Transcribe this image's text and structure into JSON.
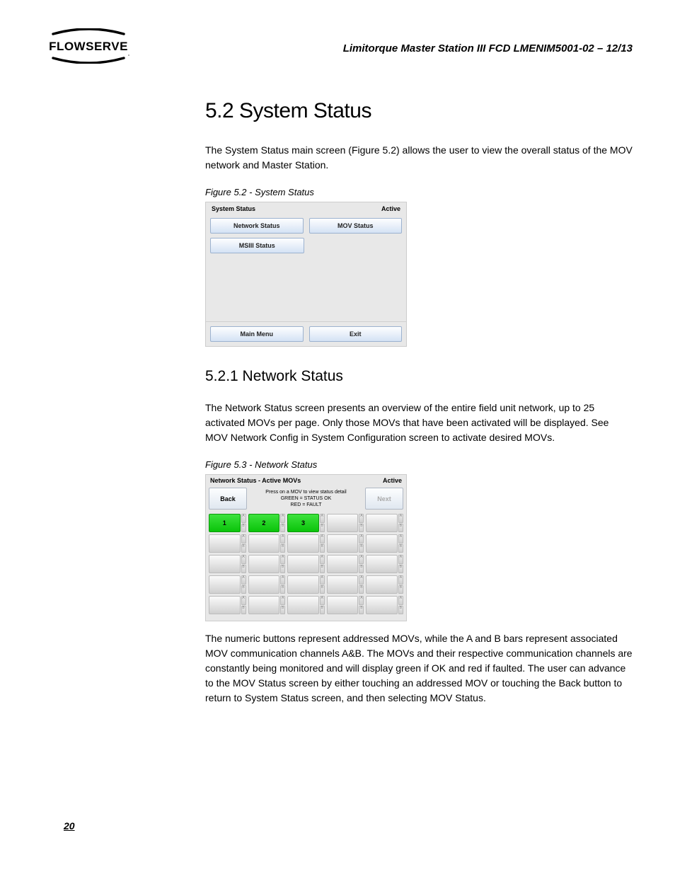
{
  "header": {
    "doc_title": "Limitorque Master Station III    FCD LMENIM5001-02 – 12/13",
    "logo_text": "FLOWSERVE"
  },
  "section": {
    "h1": "5.2 System Status",
    "p1": "The System Status main screen (Figure 5.2) allows the user to view the overall status of the MOV network and Master Station.",
    "fig52_caption": "Figure 5.2 - System Status",
    "h2": "5.2.1 Network Status",
    "p2": "The Network Status screen presents an overview of the entire field unit network, up to 25 activated MOVs per page. Only those MOVs that have been activated will be displayed. See MOV Network Config in System Configuration screen to activate desired MOVs.",
    "fig53_caption": "Figure 5.3 - Network Status",
    "p3": "The numeric buttons represent addressed MOVs, while the A and B bars represent associated MOV communication channels A&B. The MOVs and their respective communication channels are constantly being monitored and will display green if OK and red if faulted. The user can advance to the MOV Status screen by either touching an addressed MOV or touching the Back button to return to System Status screen, and then selecting MOV Status."
  },
  "fig52": {
    "title": "System Status",
    "status": "Active",
    "btn_network": "Network Status",
    "btn_mov": "MOV Status",
    "btn_msiii": "MSIII Status",
    "btn_main": "Main Menu",
    "btn_exit": "Exit"
  },
  "fig53": {
    "title": "Network Status - Active MOVs",
    "status": "Active",
    "back": "Back",
    "next": "Next",
    "hint1": "Press on a MOV to view status detail",
    "hint2": "GREEN = STATUS OK",
    "hint3": "RED = FAULT",
    "mov1": "1",
    "mov2": "2",
    "mov3": "3",
    "a": "A",
    "b": "B"
  },
  "page_number": "20"
}
